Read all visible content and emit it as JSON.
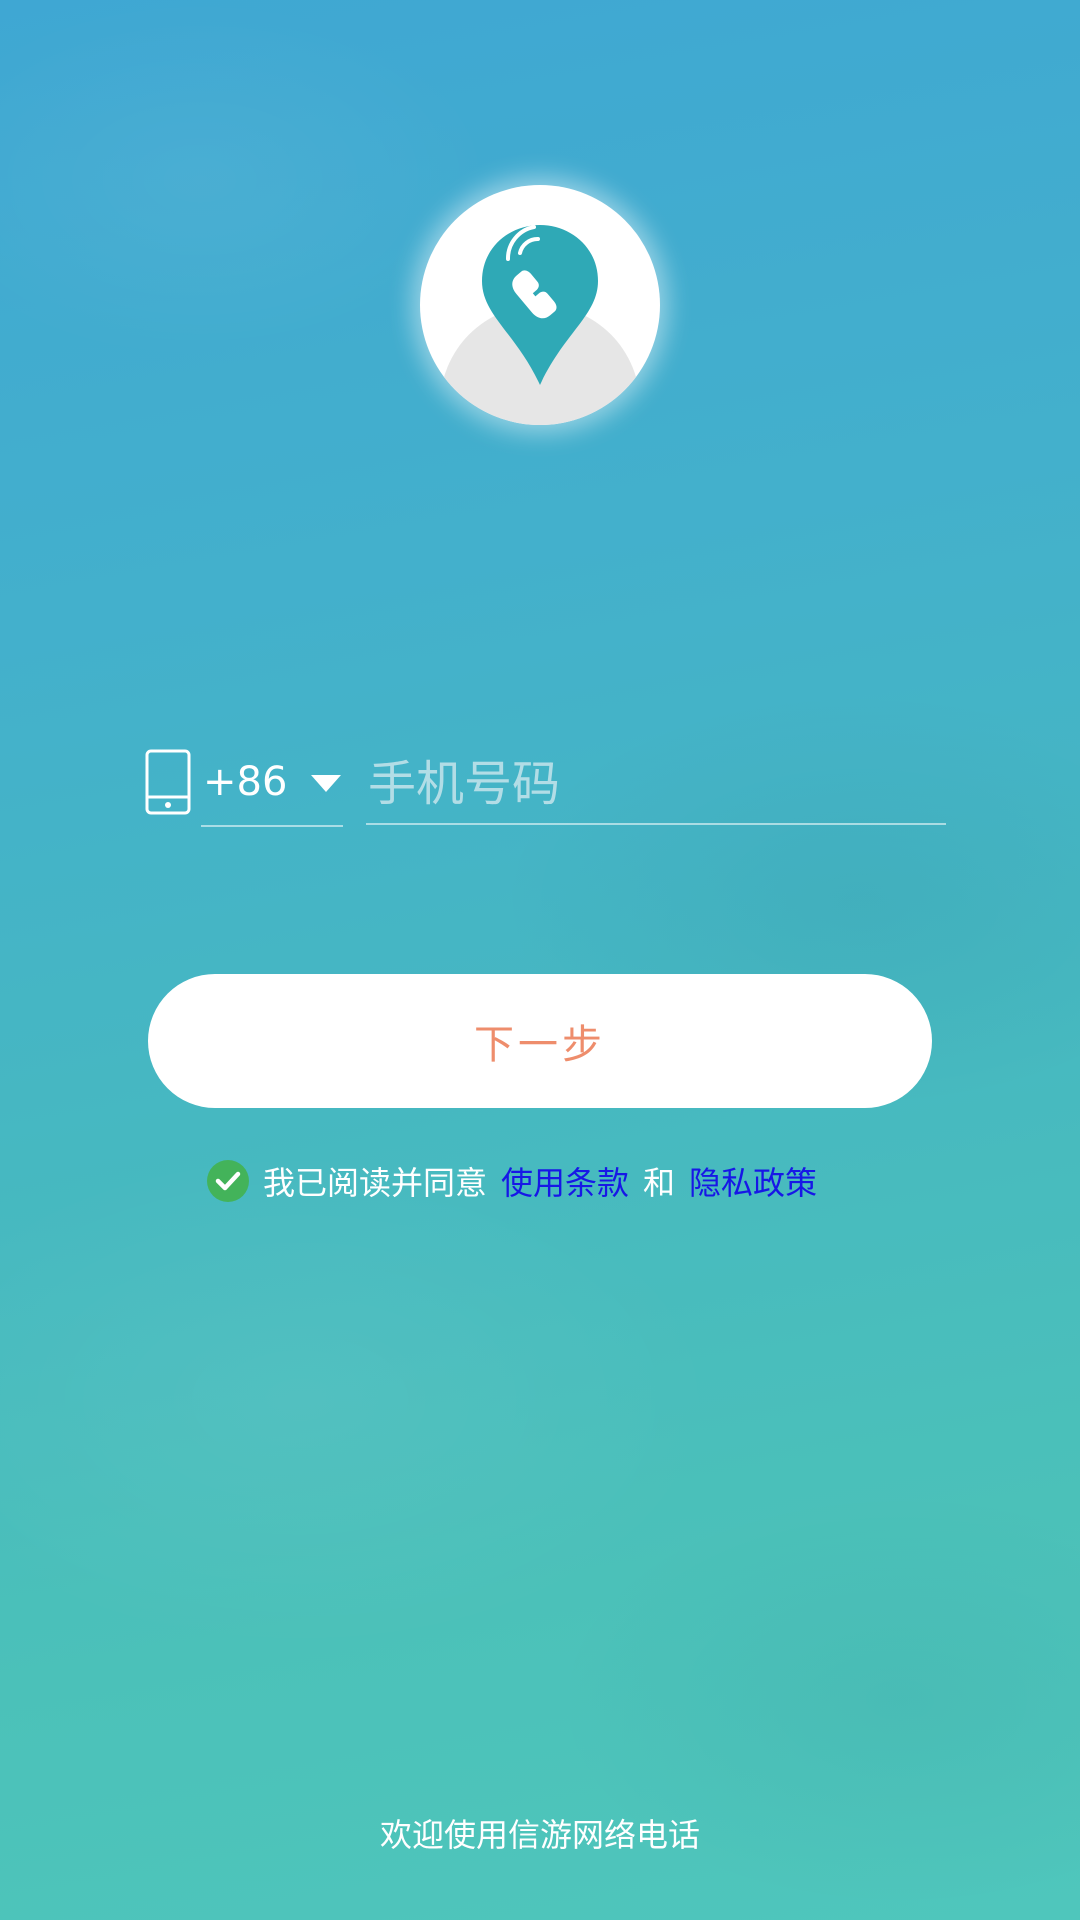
{
  "app": {
    "logo_icon": "location-pin-phone-icon"
  },
  "login": {
    "phone_icon": "mobile-phone-icon",
    "country_code": "+86",
    "country_dropdown_icon": "caret-down-icon",
    "phone_placeholder": "手机号码",
    "phone_value": "",
    "next_label": "下一步"
  },
  "agreement": {
    "checked": true,
    "check_icon": "checkmark-icon",
    "prefix": "我已阅读并同意",
    "terms_link": "使用条款",
    "conjunction": "和",
    "privacy_link": "隐私政策"
  },
  "footer": {
    "welcome_text": "欢迎使用信游网络电话"
  },
  "colors": {
    "next_text": "#ee8d6c",
    "link": "#1717e6",
    "check_bg": "#43b35a",
    "logo_accent": "#2fa9b6"
  }
}
